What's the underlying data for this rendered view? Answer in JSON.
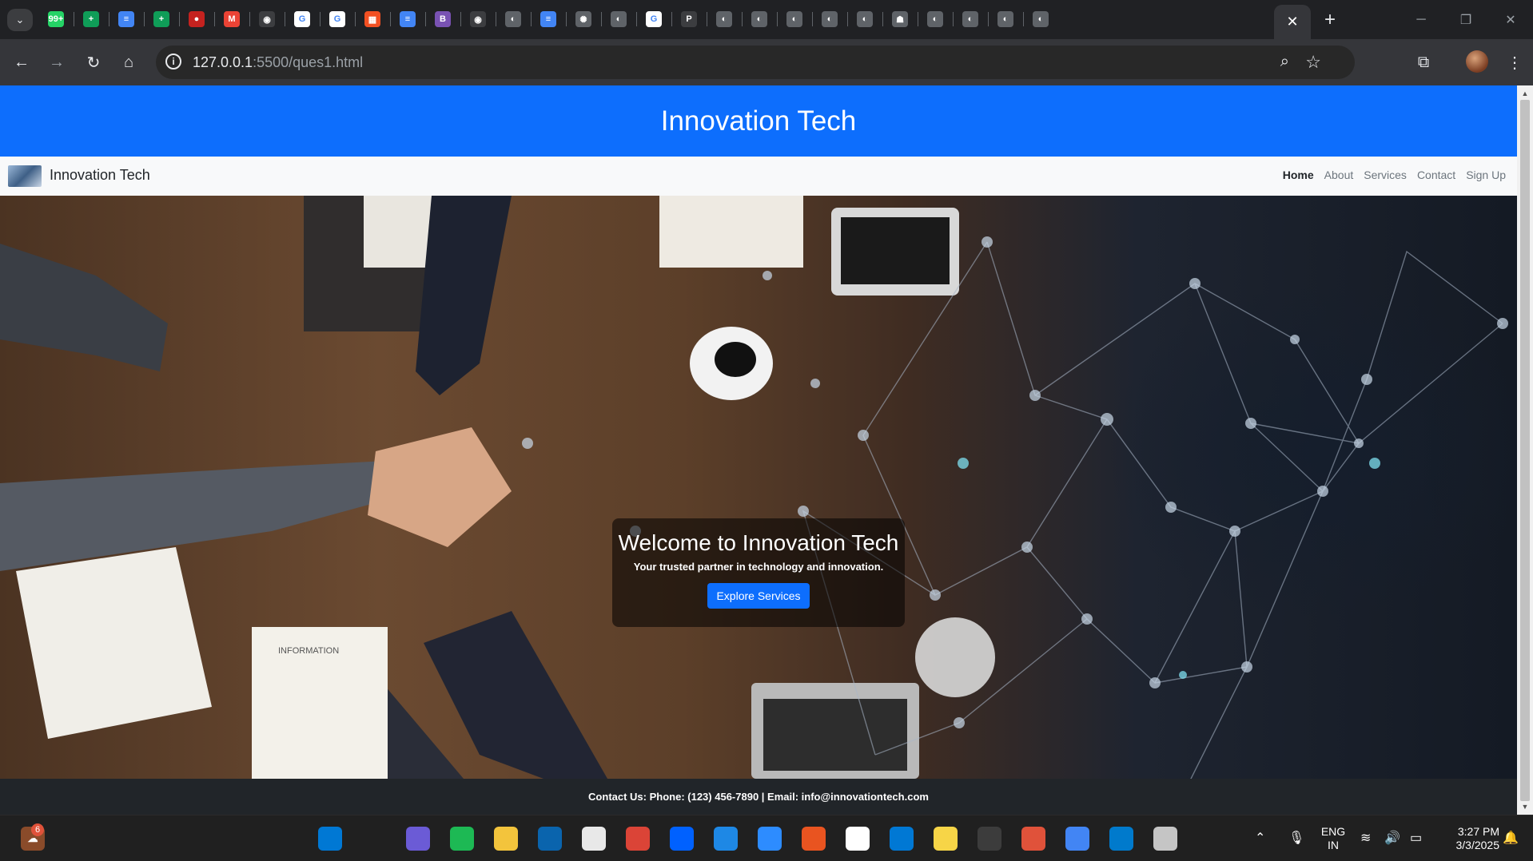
{
  "browser": {
    "tabs": [
      {
        "icon": "whatsapp-icon",
        "color": "#25d366",
        "glyph": "99+"
      },
      {
        "icon": "sheets-icon",
        "color": "#0f9d58",
        "glyph": "+"
      },
      {
        "icon": "docs-icon",
        "color": "#4285f4",
        "glyph": "≡"
      },
      {
        "icon": "sheets-icon",
        "color": "#0f9d58",
        "glyph": "+"
      },
      {
        "icon": "record-icon",
        "color": "#c5221f",
        "glyph": "●"
      },
      {
        "icon": "gmail-icon",
        "color": "#ea4335",
        "glyph": "M"
      },
      {
        "icon": "github-icon",
        "color": "#3c3d40",
        "glyph": "◉"
      },
      {
        "icon": "google-icon",
        "color": "#ffffff",
        "glyph": "G"
      },
      {
        "icon": "google-icon",
        "color": "#ffffff",
        "glyph": "G"
      },
      {
        "icon": "microsoft-icon",
        "color": "#f25022",
        "glyph": "▦"
      },
      {
        "icon": "docs-icon",
        "color": "#4285f4",
        "glyph": "≡"
      },
      {
        "icon": "bootstrap-icon",
        "color": "#7952b3",
        "glyph": "B"
      },
      {
        "icon": "github-icon",
        "color": "#3c3d40",
        "glyph": "◉"
      },
      {
        "icon": "globe-icon",
        "color": "#5f6368",
        "glyph": "◐"
      },
      {
        "icon": "docs-icon",
        "color": "#4285f4",
        "glyph": "≡"
      },
      {
        "icon": "openai-icon",
        "color": "#5f6368",
        "glyph": "✺"
      },
      {
        "icon": "globe-icon",
        "color": "#5f6368",
        "glyph": "◐"
      },
      {
        "icon": "google-icon",
        "color": "#ffffff",
        "glyph": "G"
      },
      {
        "icon": "perplexity-icon",
        "color": "#3c3d40",
        "glyph": "P"
      },
      {
        "icon": "globe-icon",
        "color": "#5f6368",
        "glyph": "◐"
      },
      {
        "icon": "globe-icon",
        "color": "#5f6368",
        "glyph": "◐"
      },
      {
        "icon": "globe-icon",
        "color": "#5f6368",
        "glyph": "◐"
      },
      {
        "icon": "globe-icon",
        "color": "#5f6368",
        "glyph": "◐"
      },
      {
        "icon": "globe-icon",
        "color": "#5f6368",
        "glyph": "◐"
      },
      {
        "icon": "robot-icon",
        "color": "#5f6368",
        "glyph": "☗"
      },
      {
        "icon": "globe-icon",
        "color": "#5f6368",
        "glyph": "◐"
      },
      {
        "icon": "globe-icon",
        "color": "#5f6368",
        "glyph": "◐"
      },
      {
        "icon": "globe-icon",
        "color": "#5f6368",
        "glyph": "◐"
      },
      {
        "icon": "globe-icon",
        "color": "#5f6368",
        "glyph": "◐"
      }
    ],
    "active_tab_close": "✕",
    "new_tab": "+",
    "url_host": "127.0.0.1",
    "url_path": ":5500/ques1.html"
  },
  "site": {
    "header_title": "Innovation Tech",
    "brand": "Innovation Tech",
    "nav": [
      "Home",
      "About",
      "Services",
      "Contact",
      "Sign Up"
    ],
    "active_nav": "Home",
    "hero_title": "Welcome to Innovation Tech",
    "hero_subtitle": "Your trusted partner in technology and innovation.",
    "hero_button": "Explore Services",
    "footer": "Contact Us: Phone: (123) 456-7890 | Email: info@innovationtech.com",
    "colors": {
      "primary": "#0d6efd",
      "footer": "#212529",
      "nav_bg": "#f8f9fa"
    }
  },
  "taskbar": {
    "weather_badge": "6",
    "apps": [
      {
        "icon": "windows-start-icon",
        "color": "#0078d4"
      },
      {
        "icon": "search-icon",
        "color": "#202020"
      },
      {
        "icon": "copilot-icon",
        "color": "#6b5bd6"
      },
      {
        "icon": "spotify-icon",
        "color": "#1db954"
      },
      {
        "icon": "file-explorer-icon",
        "color": "#f3c43c"
      },
      {
        "icon": "outlook-icon",
        "color": "#0a64ad"
      },
      {
        "icon": "store-icon",
        "color": "#e8e8e8"
      },
      {
        "icon": "chrome-icon",
        "color": "#db4437"
      },
      {
        "icon": "dropbox-icon",
        "color": "#0061ff"
      },
      {
        "icon": "window-icon",
        "color": "#1e88e5"
      },
      {
        "icon": "zoom-icon",
        "color": "#2d8cff"
      },
      {
        "icon": "ubuntu-icon",
        "color": "#e95420"
      },
      {
        "icon": "slack-icon",
        "color": "#ffffff"
      },
      {
        "icon": "network-icon",
        "color": "#0078d4"
      },
      {
        "icon": "sticky-notes-icon",
        "color": "#f7d547"
      },
      {
        "icon": "recorder-icon",
        "color": "#3c3c3c"
      },
      {
        "icon": "wps-icon",
        "color": "#e0523a"
      },
      {
        "icon": "chrome-icon",
        "color": "#4285f4"
      },
      {
        "icon": "vscode-icon",
        "color": "#007acc"
      },
      {
        "icon": "snipping-tool-icon",
        "color": "#c5c5c5"
      }
    ],
    "lang_line1": "ENG",
    "lang_line2": "IN",
    "time": "3:27 PM",
    "date": "3/3/2025"
  }
}
